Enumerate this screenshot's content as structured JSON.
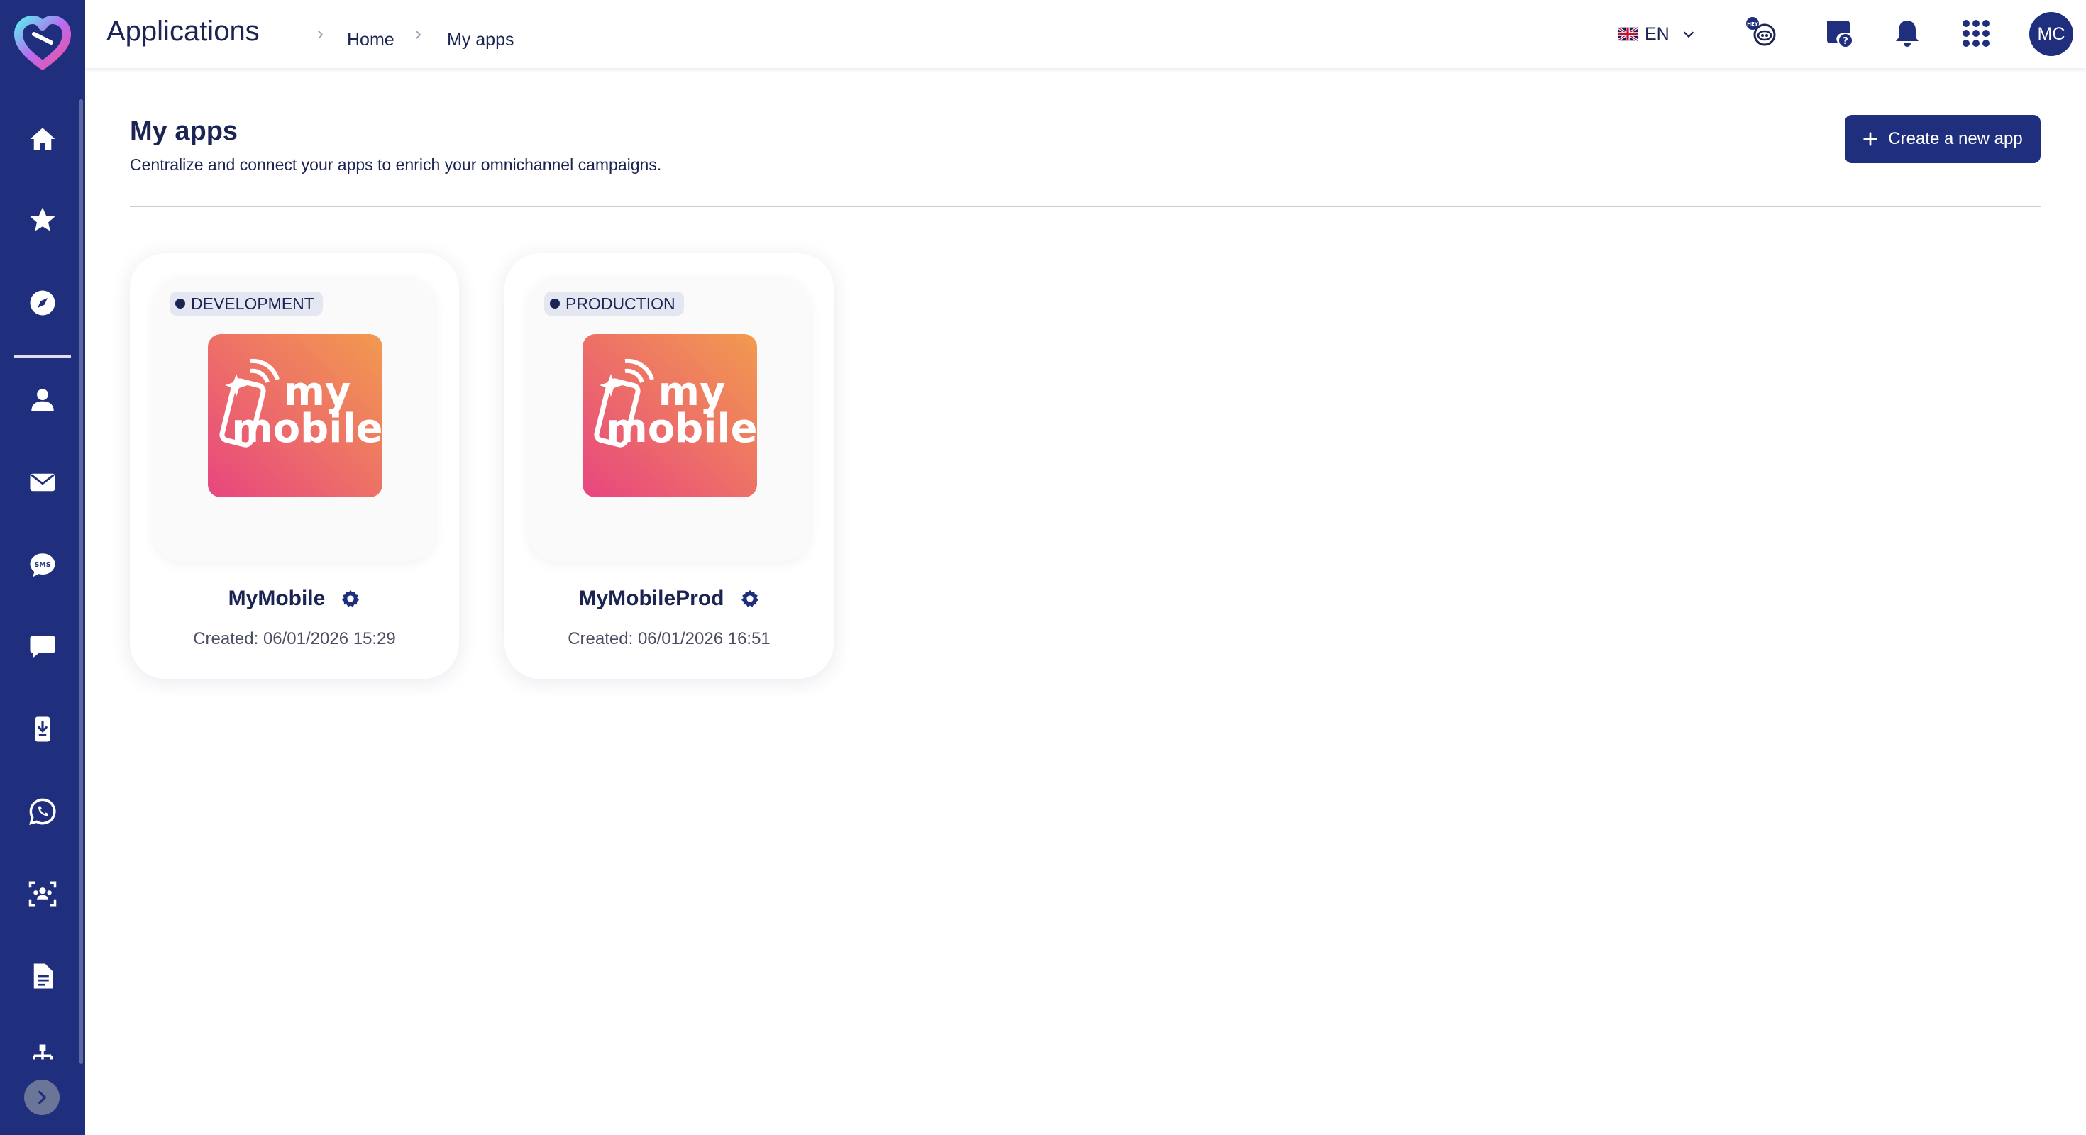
{
  "header": {
    "title": "Applications",
    "breadcrumb": [
      "Home",
      "My apps"
    ],
    "language": "EN",
    "language_flag_icon": "uk-flag-icon",
    "avatar_initials": "MC",
    "icons": [
      "hey-assistant-icon",
      "help-center-icon",
      "bell-icon",
      "apps-grid-icon"
    ],
    "hey_badge": "HEY"
  },
  "sidebar": {
    "items": [
      {
        "icon": "home-icon"
      },
      {
        "icon": "star-icon"
      },
      {
        "icon": "compass-icon"
      },
      {
        "icon": "contact-icon"
      },
      {
        "icon": "email-icon"
      },
      {
        "icon": "sms-icon",
        "glyph": "SMS"
      },
      {
        "icon": "chat-icon"
      },
      {
        "icon": "mobile-push-icon"
      },
      {
        "icon": "whatsapp-icon"
      },
      {
        "icon": "audience-icon"
      },
      {
        "icon": "document-icon"
      },
      {
        "icon": "hierarchy-icon"
      }
    ],
    "toggle_icon": "chevron-right-icon"
  },
  "page": {
    "title": "My apps",
    "subtitle": "Centralize and connect your apps to enrich your omnichannel campaigns.",
    "create_button": "Create a new app"
  },
  "apps": [
    {
      "environment": "DEVELOPMENT",
      "logo_text_1": "my",
      "logo_text_2": "mobile",
      "name": "MyMobile",
      "created": "Created: 06/01/2026 15:29"
    },
    {
      "environment": "PRODUCTION",
      "logo_text_1": "my",
      "logo_text_2": "mobile",
      "name": "MyMobileProd",
      "created": "Created: 06/01/2026 16:51"
    }
  ],
  "colors": {
    "sidebar": "#1f2f7d",
    "primary": "#1f2f7d",
    "text": "#1b2452",
    "logo_gradient_start": "#e8467f",
    "logo_gradient_end": "#f29b4f"
  }
}
